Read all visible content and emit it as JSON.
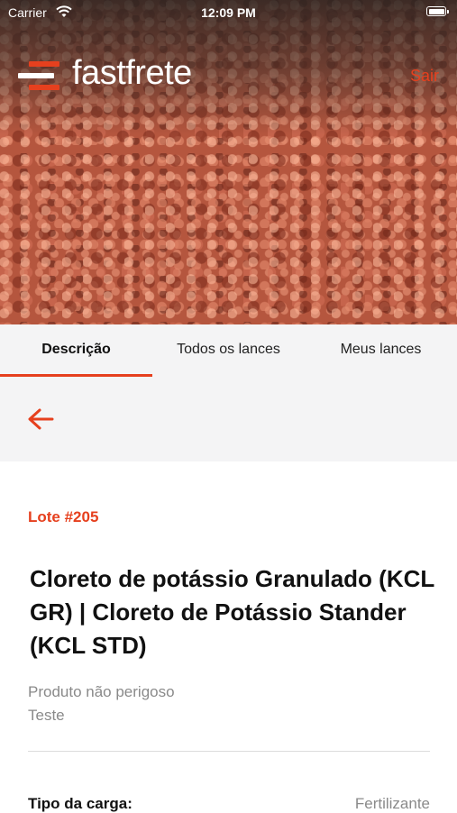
{
  "status_bar": {
    "carrier": "Carrier",
    "time": "12:09 PM"
  },
  "header": {
    "logo_text": "fastfrete",
    "logout_label": "Sair"
  },
  "tabs": [
    {
      "label": "Descrição",
      "active": true
    },
    {
      "label": "Todos os lances",
      "active": false
    },
    {
      "label": "Meus lances",
      "active": false
    }
  ],
  "lot": {
    "number": "Lote #205",
    "title": "Cloreto de potássio Granulado (KCL GR)  | Cloreto de Potássio Stander (KCL STD)",
    "hazard": "Produto não perigoso",
    "note": "Teste"
  },
  "details": [
    {
      "label": "Tipo da carga:",
      "value": "Fertilizante"
    }
  ],
  "colors": {
    "accent": "#e6401e",
    "muted": "#8a8a8a",
    "tab_bg": "#f4f4f5"
  },
  "icons": {
    "back": "arrow-left-icon",
    "wifi": "wifi-icon",
    "battery": "battery-icon"
  }
}
